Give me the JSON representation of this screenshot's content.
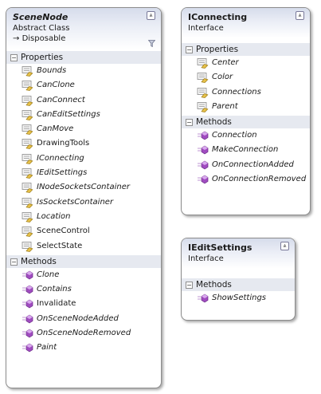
{
  "scene_node": {
    "name": "SceneNode",
    "stereotype": "Abstract Class",
    "inherits": "Disposable",
    "sections": [
      {
        "label": "Properties",
        "members": [
          {
            "name": "Bounds",
            "italic": true,
            "kind": "property"
          },
          {
            "name": "CanClone",
            "italic": true,
            "kind": "property"
          },
          {
            "name": "CanConnect",
            "italic": true,
            "kind": "property"
          },
          {
            "name": "CanEditSettings",
            "italic": true,
            "kind": "property"
          },
          {
            "name": "CanMove",
            "italic": true,
            "kind": "property"
          },
          {
            "name": "DrawingTools",
            "italic": false,
            "kind": "property"
          },
          {
            "name": "IConnecting",
            "italic": true,
            "kind": "property"
          },
          {
            "name": "IEditSettings",
            "italic": true,
            "kind": "property"
          },
          {
            "name": "INodeSocketsContainer",
            "italic": true,
            "kind": "property"
          },
          {
            "name": "IsSocketsContainer",
            "italic": true,
            "kind": "property"
          },
          {
            "name": "Location",
            "italic": true,
            "kind": "property"
          },
          {
            "name": "SceneControl",
            "italic": false,
            "kind": "property"
          },
          {
            "name": "SelectState",
            "italic": false,
            "kind": "property"
          }
        ]
      },
      {
        "label": "Methods",
        "members": [
          {
            "name": "Clone",
            "italic": true,
            "kind": "method"
          },
          {
            "name": "Contains",
            "italic": true,
            "kind": "method"
          },
          {
            "name": "Invalidate",
            "italic": false,
            "kind": "method"
          },
          {
            "name": "OnSceneNodeAdded",
            "italic": true,
            "kind": "method"
          },
          {
            "name": "OnSceneNodeRemoved",
            "italic": true,
            "kind": "method"
          },
          {
            "name": "Paint",
            "italic": true,
            "kind": "method"
          }
        ]
      }
    ]
  },
  "iconnecting": {
    "name": "IConnecting",
    "stereotype": "Interface",
    "sections": [
      {
        "label": "Properties",
        "members": [
          {
            "name": "Center",
            "italic": true,
            "kind": "property"
          },
          {
            "name": "Color",
            "italic": true,
            "kind": "property"
          },
          {
            "name": "Connections",
            "italic": true,
            "kind": "property"
          },
          {
            "name": "Parent",
            "italic": true,
            "kind": "property"
          }
        ]
      },
      {
        "label": "Methods",
        "members": [
          {
            "name": "Connection",
            "italic": true,
            "kind": "method"
          },
          {
            "name": "MakeConnection",
            "italic": true,
            "kind": "method"
          },
          {
            "name": "OnConnectionAdded",
            "italic": true,
            "kind": "method"
          },
          {
            "name": "OnConnectionRemoved",
            "italic": true,
            "kind": "method"
          }
        ]
      }
    ]
  },
  "ieditsettings": {
    "name": "IEditSettings",
    "stereotype": "Interface",
    "sections": [
      {
        "label": "Methods",
        "members": [
          {
            "name": "ShowSettings",
            "italic": true,
            "kind": "method"
          }
        ]
      }
    ]
  },
  "glyphs": {
    "collapse": "⩓",
    "section_expanded": "−",
    "inherit_arrow": "→"
  },
  "colors": {
    "header_gradient_top": "#d6dceb",
    "section_band": "#e6e9f0",
    "property_icon": "#e8c24a",
    "method_icon": "#a04cc0"
  }
}
